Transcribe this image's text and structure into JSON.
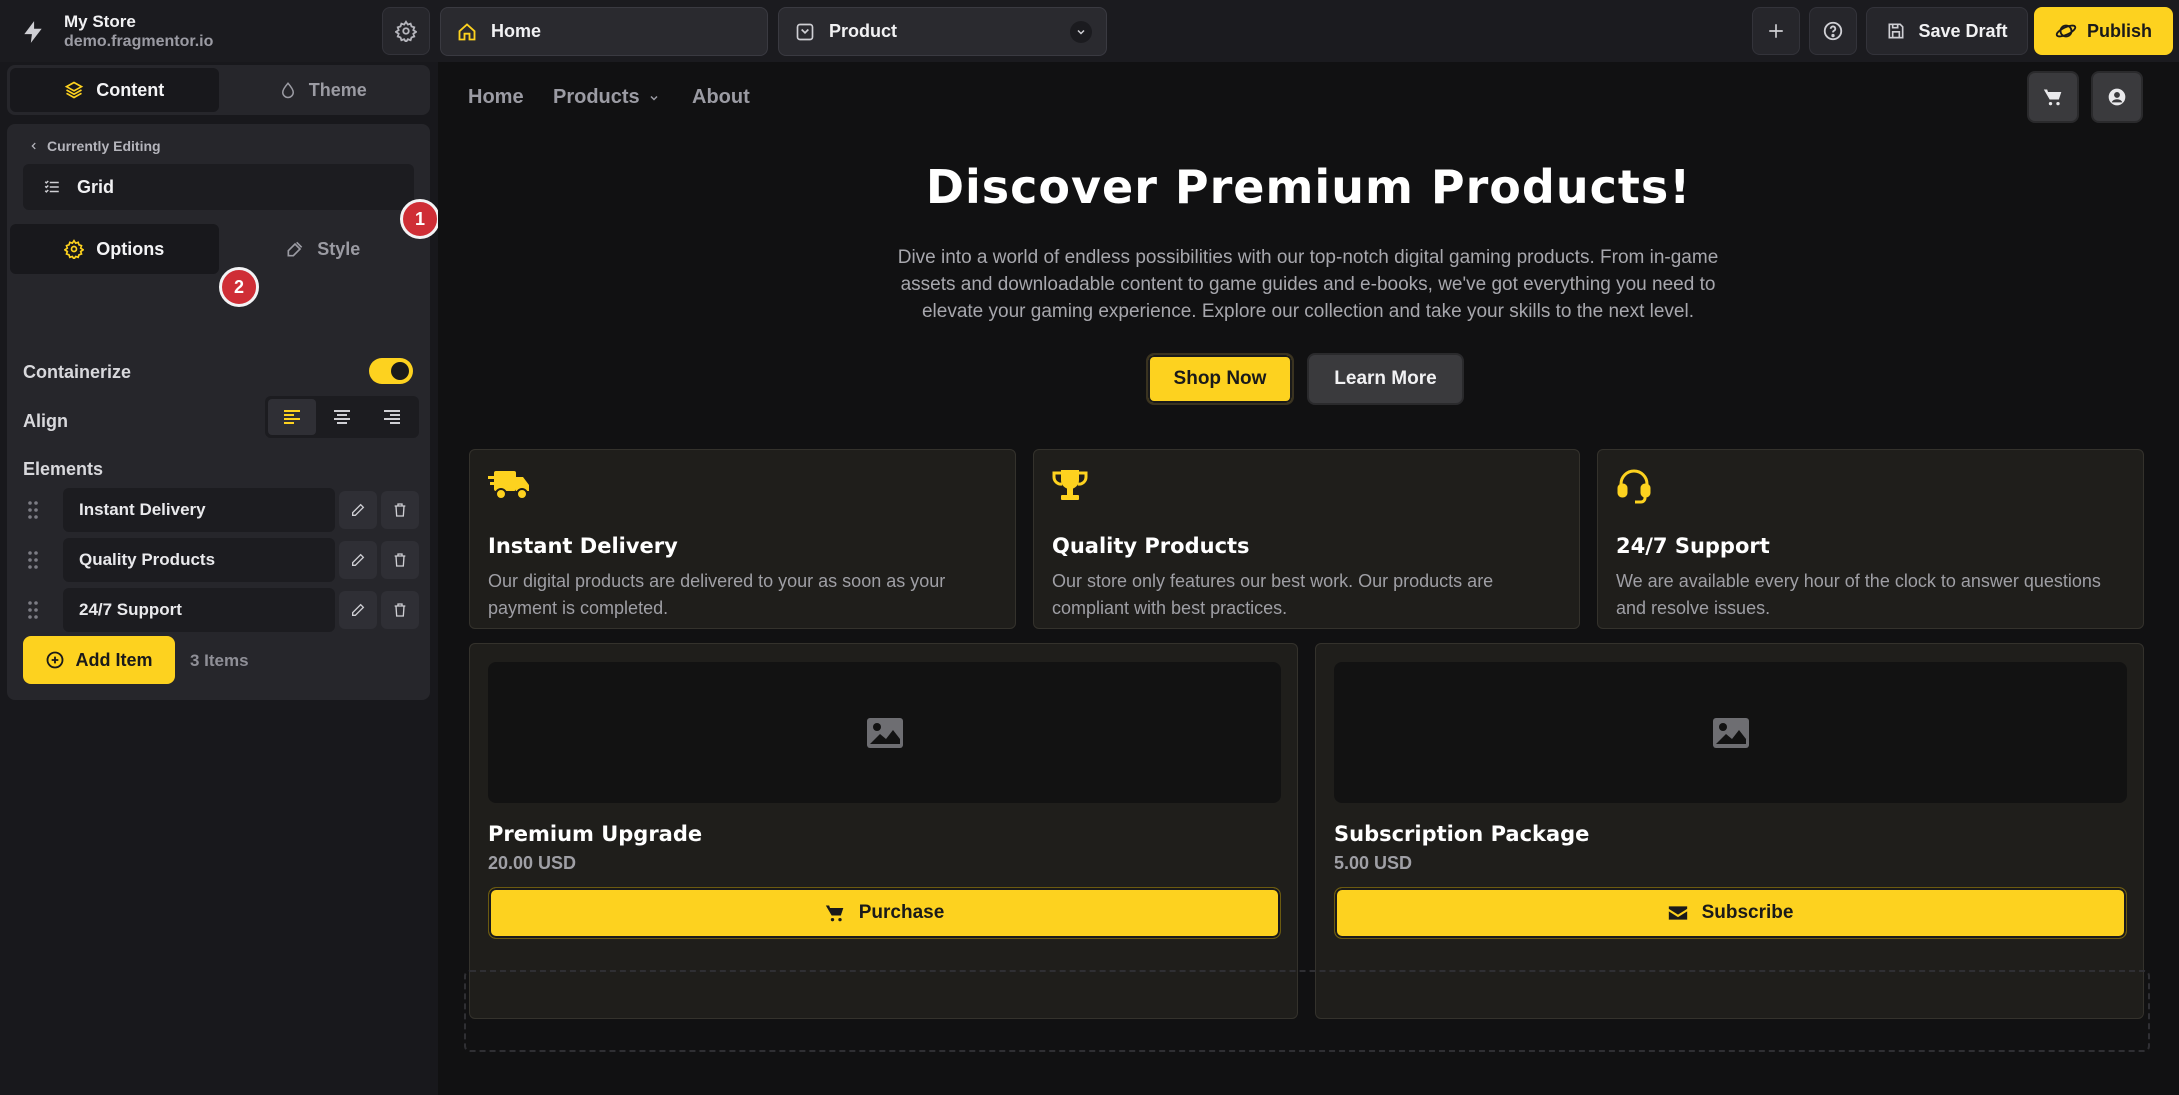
{
  "app": {
    "store_name": "My Store",
    "store_domain": "demo.fragmentor.io"
  },
  "topbar": {
    "page_select": "Home",
    "template_select": "Product",
    "save_draft_label": "Save Draft",
    "publish_label": "Publish"
  },
  "sidebar": {
    "tabs": [
      {
        "label": "Content",
        "icon": "layers-icon",
        "active": true
      },
      {
        "label": "Theme",
        "icon": "droplet-icon",
        "active": false
      }
    ],
    "currently_editing_label": "Currently Editing",
    "editing_block": "Grid",
    "badges": [
      "1",
      "2"
    ],
    "subtabs": [
      {
        "label": "Options",
        "icon": "gear-icon",
        "active": true
      },
      {
        "label": "Style",
        "icon": "paint-icon",
        "active": false
      }
    ],
    "containerize_label": "Containerize",
    "containerize_on": true,
    "align_label": "Align",
    "align_selected": "left",
    "elements_label": "Elements",
    "elements": [
      {
        "label": "Instant Delivery"
      },
      {
        "label": "Quality Products"
      },
      {
        "label": "24/7 Support"
      }
    ],
    "add_item_label": "Add Item",
    "items_count": "3 Items"
  },
  "store": {
    "nav": {
      "home": "Home",
      "products": "Products",
      "about": "About"
    },
    "hero": {
      "title": "Discover Premium Products!",
      "description": "Dive into a world of endless possibilities with our top-notch digital gaming products. From in-game assets and downloadable content to game guides and e-books, we've got everything you need to elevate your gaming experience. Explore our collection and take your skills to the next level.",
      "primary_cta": "Shop Now",
      "secondary_cta": "Learn More"
    },
    "features": [
      {
        "icon": "truck-icon",
        "title": "Instant Delivery",
        "description": "Our digital products are delivered to your as soon as your payment is completed."
      },
      {
        "icon": "trophy-icon",
        "title": "Quality Products",
        "description": "Our store only features our best work. Our products are compliant with best practices."
      },
      {
        "icon": "headset-icon",
        "title": "24/7 Support",
        "description": "We are available every hour of the clock to answer questions and resolve issues."
      }
    ],
    "products": [
      {
        "title": "Premium Upgrade",
        "price": "20.00 USD",
        "button": "Purchase",
        "button_icon": "cart-icon"
      },
      {
        "title": "Subscription Package",
        "price": "5.00 USD",
        "button": "Subscribe",
        "button_icon": "envelope-icon"
      }
    ]
  },
  "colors": {
    "accent": "#fdd21f",
    "badge": "#cf2e36",
    "background": "#141417"
  }
}
